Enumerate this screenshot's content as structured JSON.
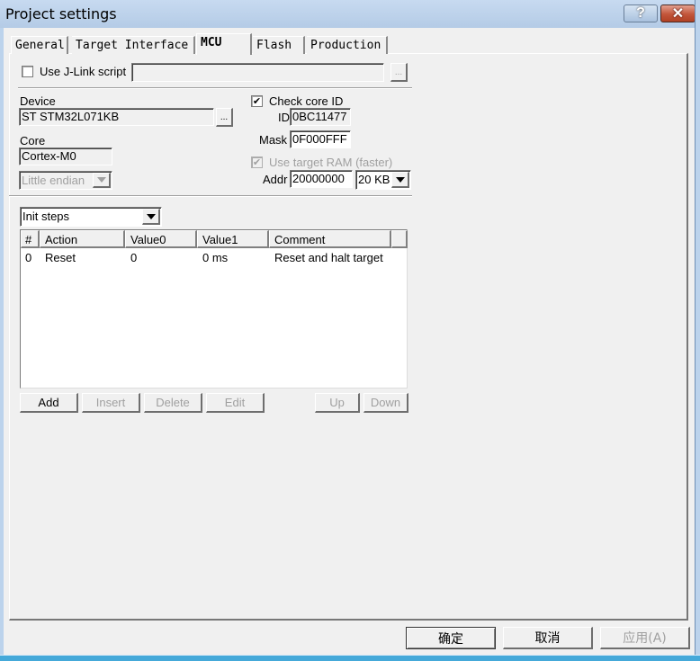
{
  "window": {
    "title": "Project settings",
    "help_button": "?",
    "close_button": "✕"
  },
  "tabs": [
    {
      "label": "General",
      "active": false
    },
    {
      "label": "Target Interface",
      "active": false
    },
    {
      "label": "MCU",
      "active": true
    },
    {
      "label": "Flash",
      "active": false
    },
    {
      "label": "Production",
      "active": false
    }
  ],
  "jlink_script": {
    "label": "Use J-Link script",
    "checked": false,
    "value": "",
    "browse_label": "..."
  },
  "device": {
    "label": "Device",
    "value": "ST STM32L071KB",
    "browse_label": "..."
  },
  "core": {
    "label": "Core",
    "value": "Cortex-M0",
    "endian": "Little endian"
  },
  "check_core_id": {
    "label": "Check core ID",
    "checked": true,
    "id_label": "ID",
    "id_value": "0BC11477",
    "mask_label": "Mask",
    "mask_value": "0F000FFF"
  },
  "target_ram": {
    "label": "Use target RAM (faster)",
    "checked": true,
    "addr_label": "Addr",
    "addr_value": "20000000",
    "size": "20 KB"
  },
  "steps": {
    "selected": "Init steps",
    "columns": [
      "#",
      "Action",
      "Value0",
      "Value1",
      "Comment"
    ],
    "rows": [
      {
        "num": "0",
        "action": "Reset",
        "value0": "0",
        "value1": "0 ms",
        "comment": "Reset and halt target"
      }
    ],
    "buttons": {
      "add": "Add",
      "insert": "Insert",
      "delete": "Delete",
      "edit": "Edit",
      "up": "Up",
      "down": "Down"
    }
  },
  "footer": {
    "ok": "确定",
    "cancel": "取消",
    "apply": "应用(A)"
  },
  "icons": {
    "checkmark": "✔"
  }
}
